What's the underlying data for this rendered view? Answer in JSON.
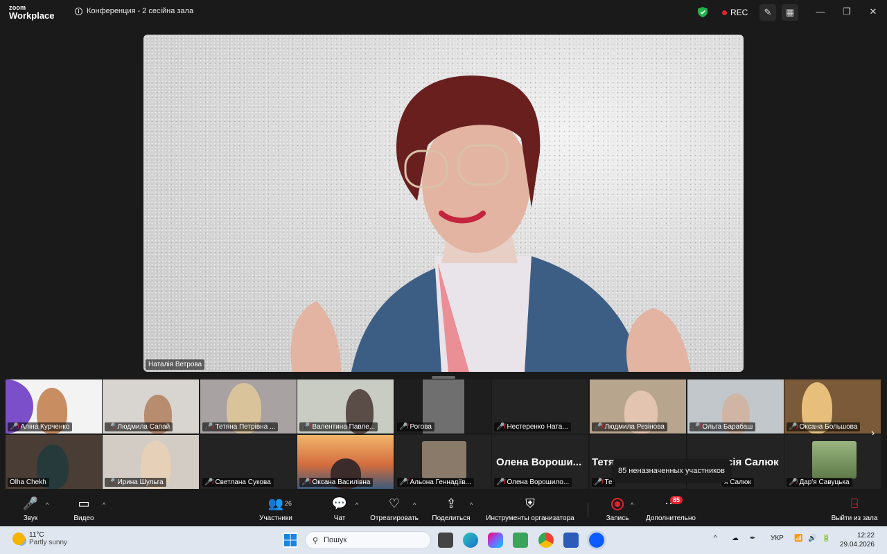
{
  "titlebar": {
    "logo_small": "zoom",
    "logo_big": "Workplace",
    "meeting_title": "Конференция - 2 сесійна зала",
    "rec_label": "REC",
    "colors": {
      "secure": "#22b14c",
      "rec": "#e0242f"
    }
  },
  "main_video": {
    "speaker_name": "Наталія Ветрова"
  },
  "gallery": {
    "row1": [
      "Аліна Курченко",
      "Людмила Сапай",
      "Тетяна  Петрівна ...",
      "Валентина Павле...",
      "Рогова",
      "Нестеренко Ната...",
      "Людмила Резінова",
      "Ольга Барабаш",
      "Оксана Большова"
    ],
    "row2": [
      "Olha Chekh",
      "Ирина Шульга",
      "Светлана Сукова",
      "Оксана Василівна",
      "Альона Геннадіїв...",
      "Олена Ворошило...",
      "Те",
      "я Салюк",
      "Дар'я Савуцька"
    ],
    "big_names": [
      "Олена  Вороши...",
      "Тетя",
      "сія Салюк"
    ],
    "tooltip": "85 неназначенных участников"
  },
  "toolbar": {
    "audio": "Звук",
    "video": "Видео",
    "participants": "Участники",
    "participants_count": "26",
    "chat": "Чат",
    "react": "Отреагировать",
    "share": "Поделиться",
    "host_tools": "Инструменты организатора",
    "record": "Запись",
    "more": "Дополнительно",
    "more_badge": "85",
    "leave": "Выйти из зала"
  },
  "taskbar": {
    "temp": "11°C",
    "weather": "Partly sunny",
    "search_placeholder": "Пошук",
    "lang": "УКР",
    "time": "12:22",
    "date": "29.04.2026"
  }
}
